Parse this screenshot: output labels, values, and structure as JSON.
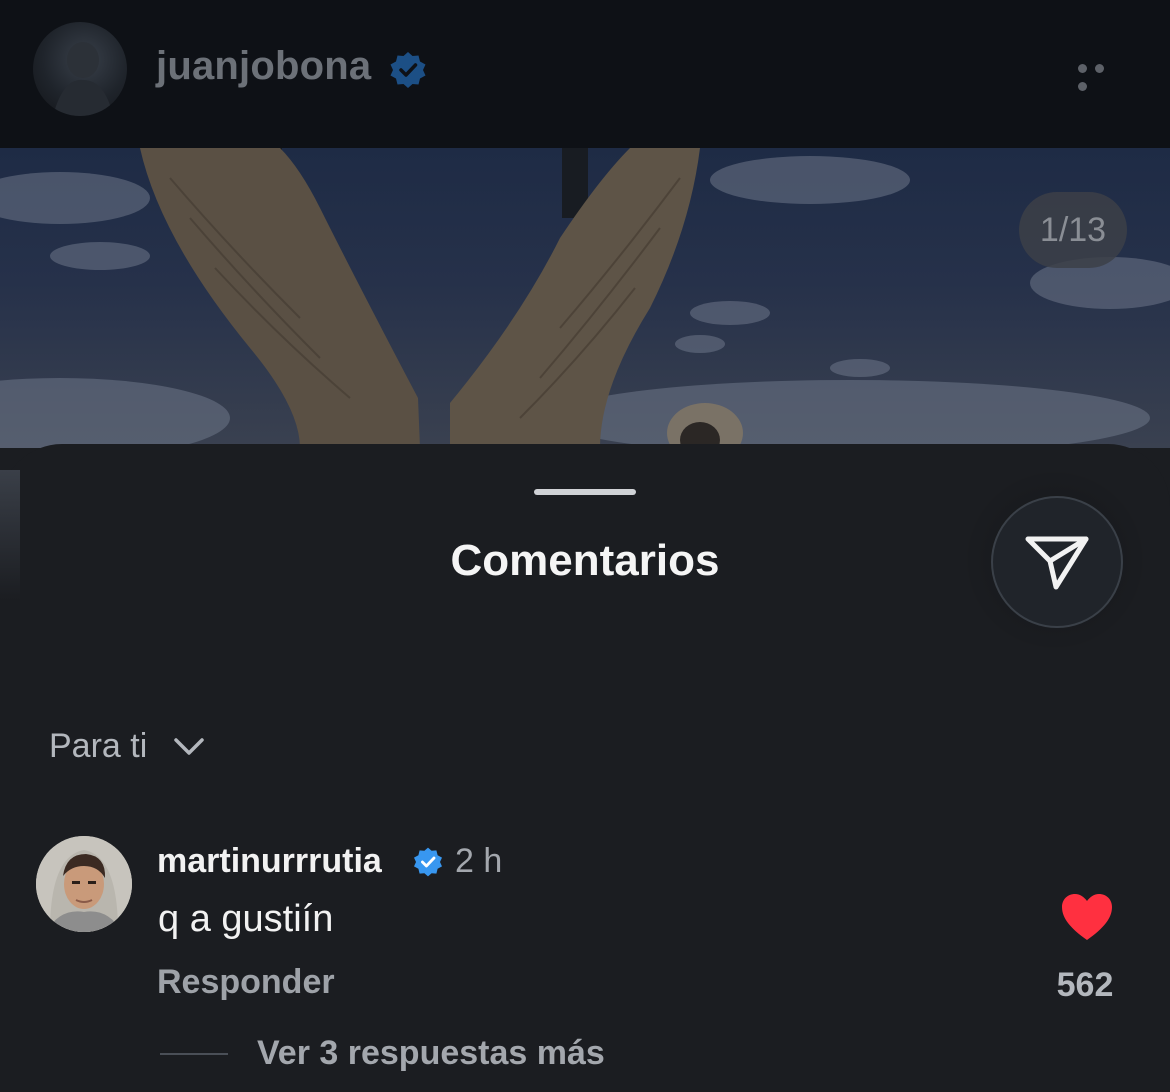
{
  "header": {
    "username": "juanjobona",
    "verified_icon": "verified-badge-icon",
    "more_icon": "more-options-icon"
  },
  "post": {
    "page_counter": "1/13"
  },
  "comments_sheet": {
    "title": "Comentarios",
    "share_icon": "send-icon",
    "filter_label": "Para ti",
    "filter_icon": "chevron-down-icon"
  },
  "comment": {
    "username": "martinurrrutia",
    "time": "2 h",
    "text": "q a gustiín",
    "reply_label": "Responder",
    "like_count": "562",
    "like_icon": "heart-filled-icon",
    "view_replies": "Ver 3 respuestas más"
  },
  "colors": {
    "background": "#1b1d21",
    "verified": "#3897f0",
    "heart": "#ff3040"
  }
}
